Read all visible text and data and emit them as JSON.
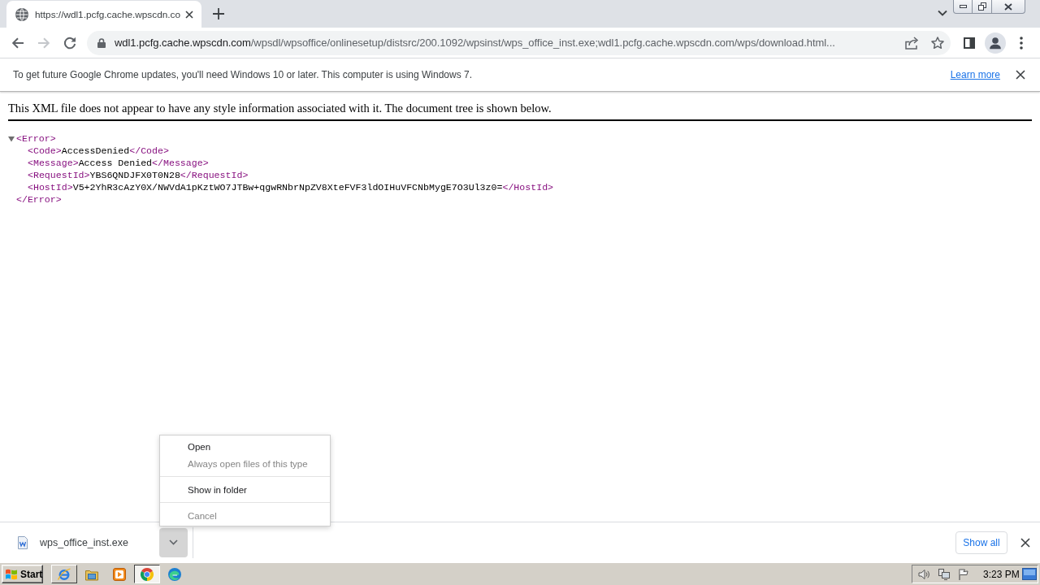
{
  "tabs": [
    {
      "title": "https://wdl1.pcfg.cache.wpscdn.co",
      "selected": true
    }
  ],
  "nav_buttons": [
    {
      "kind": "back",
      "disabled": false
    },
    {
      "kind": "forward",
      "disabled": true
    },
    {
      "kind": "reload",
      "disabled": false
    }
  ],
  "address_bar": {
    "host": "wdl1.pcfg.cache.wpscdn.com",
    "path": "/wpsdl/wpsoffice/onlinesetup/distsrc/200.1092/wpsinst/wps_office_inst.exe;wdl1.pcfg.cache.wpscdn.com/wps/download.html...",
    "bookmarked": false
  },
  "info_bar": {
    "message": "To get future Google Chrome updates, you'll need Windows 10 or later. This computer is using Windows 7.",
    "link": "Learn more"
  },
  "document": {
    "notice": "This XML file does not appear to have any style information associated with it. The document tree is shown below.",
    "tree": {
      "open_tag": "<Error>",
      "close_tag": "</Error>",
      "expanded": true,
      "children": [
        {
          "open_tag": "<Code>",
          "text": "AccessDenied",
          "close_tag": "</Code>"
        },
        {
          "open_tag": "<Message>",
          "text": "Access Denied",
          "close_tag": "</Message>"
        },
        {
          "open_tag": "<RequestId>",
          "text": "YBS6QNDJFX0T0N28",
          "close_tag": "</RequestId>"
        },
        {
          "open_tag": "<HostId>",
          "text": "V5+2YhR3cAzY0X/NWVdA1pKztWO7JTBw+qgwRNbrNpZV8XteFVF3ldOIHuVFCNbMygE7O3Ul3z0=",
          "close_tag": "</HostId>"
        }
      ]
    }
  },
  "download_bar": {
    "items": [
      {
        "filename": "wps_office_inst.exe",
        "expanded": true,
        "menu": {
          "groups": [
            {
              "items": [
                {
                  "label": "Open",
                  "disabled": false
                },
                {
                  "label": "Always open files of this type",
                  "disabled": true
                }
              ]
            },
            {
              "items": [
                {
                  "label": "Show in folder",
                  "disabled": false
                }
              ]
            },
            {
              "items": [
                {
                  "label": "Cancel",
                  "disabled": true
                }
              ]
            }
          ]
        }
      }
    ],
    "show_all": "Show all"
  },
  "taskbar": {
    "start": "Start",
    "apps": [
      {
        "kind": "ie",
        "running": true,
        "selected": false
      },
      {
        "kind": "folder",
        "running": false,
        "selected": false
      },
      {
        "kind": "player",
        "running": false,
        "selected": false
      },
      {
        "kind": "chrome",
        "running": true,
        "selected": true
      },
      {
        "kind": "edge",
        "running": false,
        "selected": false
      }
    ],
    "clock": "3:23 PM"
  }
}
